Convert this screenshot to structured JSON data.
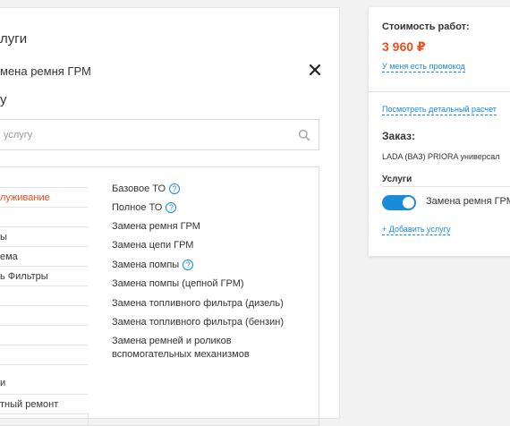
{
  "modal": {
    "heading": "луги",
    "selected_service": "мена ремня ГРМ",
    "subheading": "у",
    "search": {
      "placeholder": "услугу",
      "value": ""
    }
  },
  "categories": [
    {
      "label": "",
      "active": false
    },
    {
      "label": "луживание",
      "active": true
    },
    {
      "label": "",
      "active": false
    },
    {
      "label": "ы",
      "active": false
    },
    {
      "label": "ема",
      "active": false
    },
    {
      "label": "ь Фильтры",
      "active": false
    },
    {
      "label": "",
      "active": false
    },
    {
      "label": "",
      "active": false
    },
    {
      "label": "",
      "active": false
    },
    {
      "label": "",
      "active": false
    },
    {
      "label": "и",
      "active": false
    },
    {
      "label": "тный ремонт",
      "active": false
    }
  ],
  "services": [
    {
      "label": "Базовое ТО",
      "help": true
    },
    {
      "label": "Полное ТО",
      "help": true
    },
    {
      "label": "Замена ремня ГРМ",
      "help": false
    },
    {
      "label": "Замена цепи ГРМ",
      "help": false
    },
    {
      "label": "Замена помпы",
      "help": true
    },
    {
      "label": "Замена помпы (цепной ГРМ)",
      "help": false
    },
    {
      "label": "Замена топливного фильтра (дизель)",
      "help": false
    },
    {
      "label": "Замена топливного фильтра (бензин)",
      "help": false
    },
    {
      "label": "Замена ремней и роликов вспомогательных механизмов",
      "help": false
    }
  ],
  "order": {
    "cost_label": "Стоимость работ:",
    "cost_value": "3 960 ₽",
    "promo_link": "У меня есть промокод",
    "details_link": "Посмотреть детальный расчет",
    "order_label": "Заказ:",
    "car": "LADA (ВАЗ) PRIORA универсал",
    "services_label": "Услуги",
    "service_item": "Замена ремня ГРМ",
    "service_enabled": true,
    "add_service": "+ Добавить услугу"
  },
  "colors": {
    "accent_orange": "#e8501f",
    "link_blue": "#1a8bd8"
  },
  "icons": {
    "close": "close-icon",
    "search": "search-icon",
    "help": "question-circle-icon"
  }
}
